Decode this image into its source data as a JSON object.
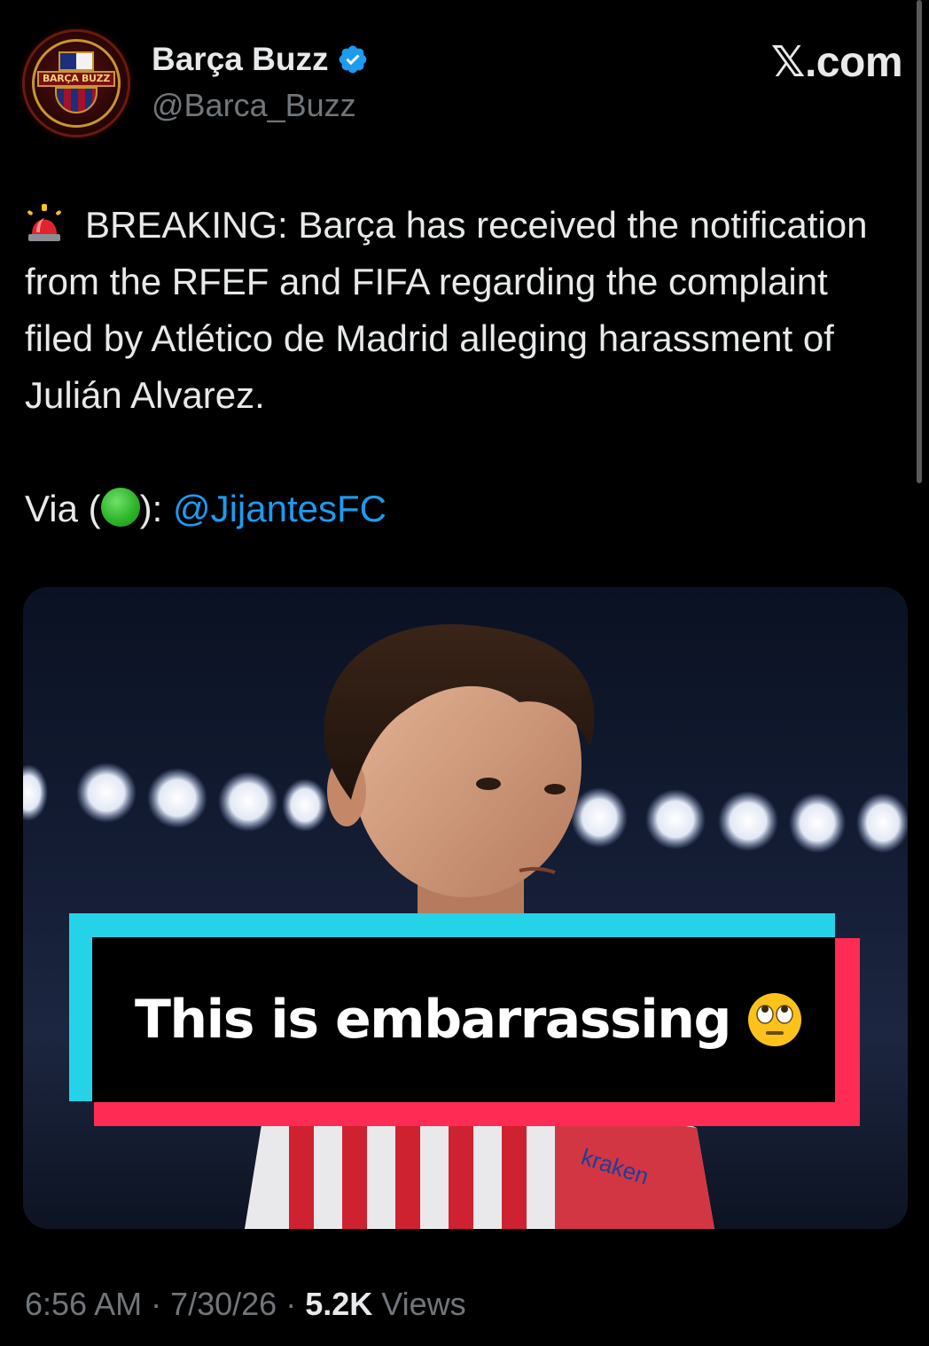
{
  "author": {
    "display_name": "Barça Buzz",
    "handle": "@Barca_Buzz",
    "avatar_text": "BARÇA BUZZ",
    "verified": true
  },
  "site_logo": "𝕏.com",
  "tweet": {
    "breaking_text": "BREAKING: Barça has received the notification from the RFEF and FIFA regarding the complaint filed by Atlético de Madrid alleging harassment of Julián Alvarez.",
    "via_prefix": "Via (",
    "via_suffix": "): ",
    "mention": "@JijantesFC",
    "icons": {
      "siren": "rotating-light-icon",
      "source_dot": "green-circle-icon",
      "caption_emoji": "face-with-rolling-eyes-icon"
    }
  },
  "media": {
    "caption": "This is embarrassing",
    "shirt_sponsor": "kraken"
  },
  "meta": {
    "time": "6:56 AM",
    "separator": " · ",
    "date": "7/30/26",
    "views_count": "5.2K",
    "views_label": " Views"
  },
  "colors": {
    "background": "#000000",
    "text": "#e7e9ea",
    "secondary": "#71767b",
    "link": "#1d9bf0",
    "caption_cyan": "#25d3e9",
    "caption_red": "#fe2c55"
  }
}
